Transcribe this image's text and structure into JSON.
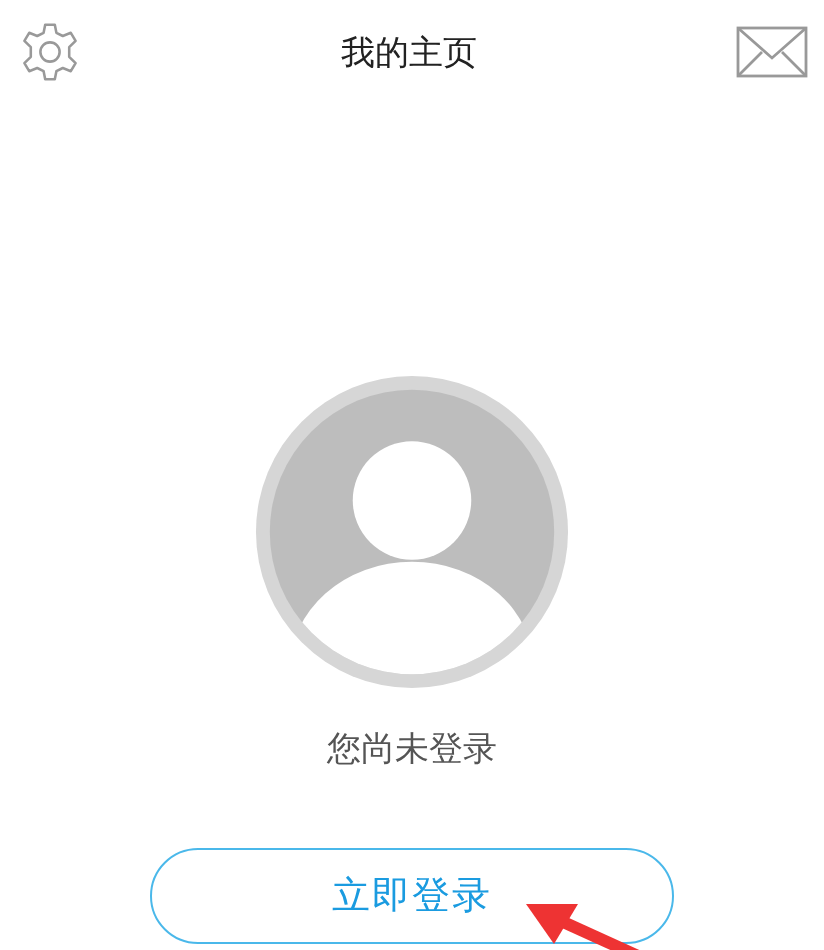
{
  "header": {
    "title": "我的主页"
  },
  "profile": {
    "status": "您尚未登录"
  },
  "login_button": {
    "label": "立即登录"
  }
}
